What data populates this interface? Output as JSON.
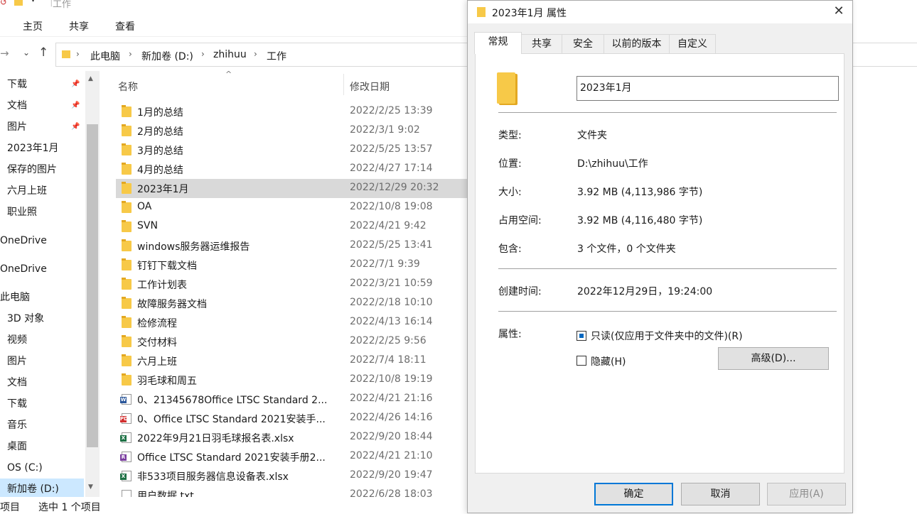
{
  "explorer": {
    "window_title": "工作",
    "ribbon_tabs": [
      "主页",
      "共享",
      "查看"
    ],
    "breadcrumb": [
      "此电脑",
      "新加卷 (D:)",
      "zhihuu",
      "工作"
    ],
    "columns": {
      "name": "名称",
      "date": "修改日期"
    },
    "sidebar": [
      {
        "label": "下载",
        "pinned": true
      },
      {
        "label": "文档",
        "pinned": true
      },
      {
        "label": "图片",
        "pinned": true
      },
      {
        "label": "2023年1月"
      },
      {
        "label": "保存的图片"
      },
      {
        "label": "六月上班"
      },
      {
        "label": "职业照"
      },
      {
        "label": "OneDrive"
      },
      {
        "label": "OneDrive"
      },
      {
        "label": "此电脑"
      },
      {
        "label": "3D 对象"
      },
      {
        "label": "视频"
      },
      {
        "label": "图片"
      },
      {
        "label": "文档"
      },
      {
        "label": "下载"
      },
      {
        "label": "音乐"
      },
      {
        "label": "桌面"
      },
      {
        "label": "OS (C:)"
      },
      {
        "label": "新加卷 (D:)",
        "selected": true
      }
    ],
    "files": [
      {
        "name": "1月的总结",
        "date": "2022/2/25 13:39",
        "type": "folder"
      },
      {
        "name": "2月的总结",
        "date": "2022/3/1 9:02",
        "type": "folder"
      },
      {
        "name": "3月的总结",
        "date": "2022/5/25 13:57",
        "type": "folder"
      },
      {
        "name": "4月的总结",
        "date": "2022/4/27 17:14",
        "type": "folder"
      },
      {
        "name": "2023年1月",
        "date": "2022/12/29 20:32",
        "type": "folder",
        "selected": true
      },
      {
        "name": "OA",
        "date": "2022/10/8 19:08",
        "type": "folder"
      },
      {
        "name": "SVN",
        "date": "2022/4/21 9:42",
        "type": "folder"
      },
      {
        "name": "windows服务器运维报告",
        "date": "2022/5/25 13:41",
        "type": "folder"
      },
      {
        "name": "钉钉下载文档",
        "date": "2022/7/1 9:39",
        "type": "folder"
      },
      {
        "name": "工作计划表",
        "date": "2022/3/21 10:59",
        "type": "folder"
      },
      {
        "name": "故障服务器文档",
        "date": "2022/2/18 10:10",
        "type": "folder"
      },
      {
        "name": "检修流程",
        "date": "2022/4/13 16:14",
        "type": "folder"
      },
      {
        "name": "交付材料",
        "date": "2022/2/25 9:56",
        "type": "folder"
      },
      {
        "name": "六月上班",
        "date": "2022/7/4 18:11",
        "type": "folder"
      },
      {
        "name": "羽毛球和周五",
        "date": "2022/10/8 19:19",
        "type": "folder"
      },
      {
        "name": "0、21345678Office LTSC Standard 2...",
        "date": "2022/4/21 21:16",
        "type": "word"
      },
      {
        "name": "0、Office LTSC Standard 2021安装手...",
        "date": "2022/4/26 14:16",
        "type": "pdf"
      },
      {
        "name": "2022年9月21日羽毛球报名表.xlsx",
        "date": "2022/9/20 18:44",
        "type": "excel"
      },
      {
        "name": "Office LTSC Standard 2021安装手册2...",
        "date": "2022/4/21 21:10",
        "type": "rar"
      },
      {
        "name": "非533项目服务器信息设备表.xlsx",
        "date": "2022/9/20 19:47",
        "type": "excel"
      },
      {
        "name": "用户数据.txt",
        "date": "2022/6/28 18:03",
        "type": "txt"
      }
    ],
    "status": {
      "items": "项目",
      "selected": "选中 1 个项目"
    }
  },
  "dialog": {
    "title": "2023年1月 属性",
    "tabs": [
      "常规",
      "共享",
      "安全",
      "以前的版本",
      "自定义"
    ],
    "name_value": "2023年1月",
    "props": {
      "type_label": "类型:",
      "type_value": "文件夹",
      "location_label": "位置:",
      "location_value": "D:\\zhihuu\\工作",
      "size_label": "大小:",
      "size_value": "3.92 MB (4,113,986 字节)",
      "disk_label": "占用空间:",
      "disk_value": "3.92 MB (4,116,480 字节)",
      "contains_label": "包含:",
      "contains_value": "3 个文件，0 个文件夹",
      "created_label": "创建时间:",
      "created_value": "2022年12月29日，19:24:00",
      "attr_label": "属性:"
    },
    "readonly_label": "只读(仅应用于文件夹中的文件)(R)",
    "hidden_label": "隐藏(H)",
    "advanced_label": "高级(D)...",
    "buttons": {
      "ok": "确定",
      "cancel": "取消",
      "apply": "应用(A)"
    }
  }
}
